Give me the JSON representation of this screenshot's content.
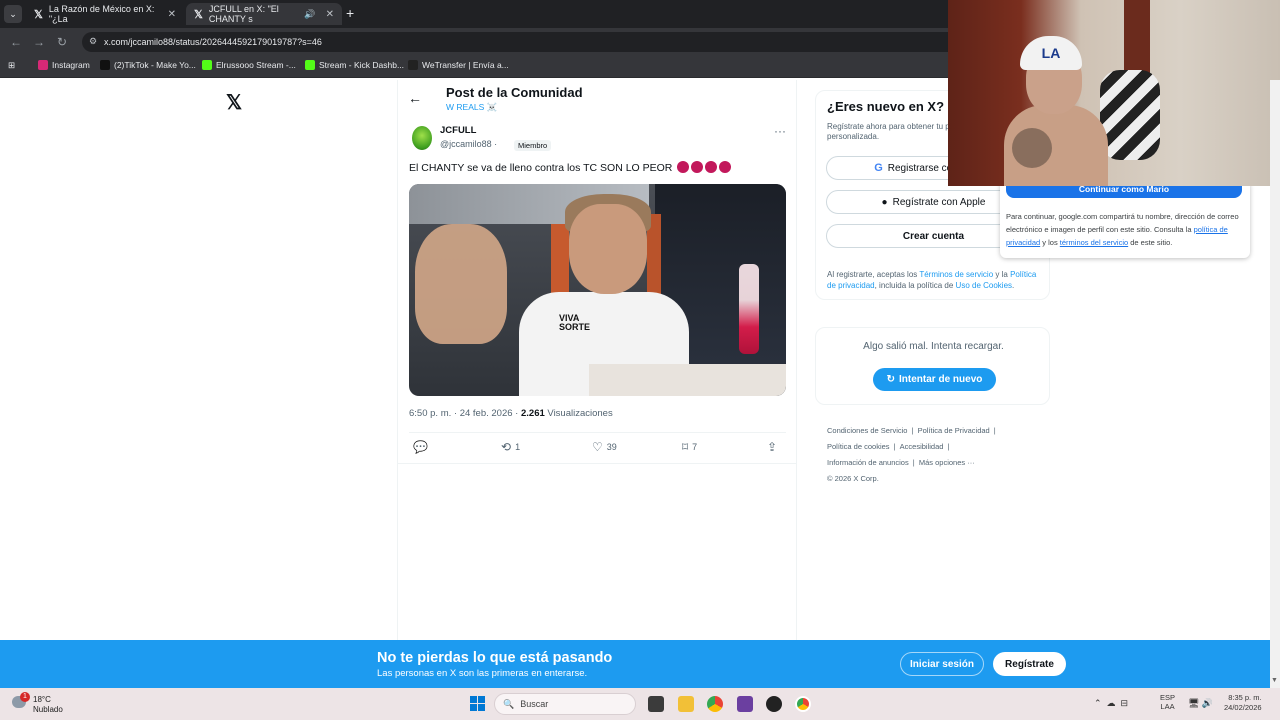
{
  "browser": {
    "tabs": [
      {
        "title": "La Razón de México en X: \"¿La",
        "active": false
      },
      {
        "title": "JCFULL en X: \"El CHANTY s",
        "active": true
      }
    ],
    "url": "x.com/jccamilo88/status/2026444592179019787?s=46",
    "bookmarks": [
      "Instagram",
      "(2)TikTok - Make Yo...",
      "Elrussooo Stream -...",
      "Stream - Kick Dashb...",
      "WeTransfer | Envía a..."
    ]
  },
  "post": {
    "header_title": "Post de la Comunidad",
    "community": "W REALS ☠️",
    "author_name": "JCFULL",
    "author_handle": "@jccamilo88",
    "member_badge": "Miembro",
    "text": "El CHANTY se va de lleno contra los TC SON LO PEOR",
    "time": "6:50 p. m.",
    "date": "24 feb. 2026",
    "views_count": "2.261",
    "views_label": "Visualizaciones",
    "retweets": "1",
    "likes": "39",
    "bookmarks": "7",
    "video_text": [
      "VIVA",
      "SORTE"
    ]
  },
  "sidebar": {
    "new_title": "¿Eres nuevo en X?",
    "new_desc": "Regístrate ahora para obtener tu propia cronología personalizada.",
    "google_label": "Registrarse con Google",
    "apple_label": "Regístrate con Apple",
    "create_label": "Crear cuenta",
    "legal_prefix": "Al registrarte, aceptas los",
    "legal_terms": "Términos de servicio",
    "legal_and": "y la",
    "legal_privacy": "Política de privacidad",
    "legal_mid": ", incluida la política de",
    "legal_cookies": "Uso de Cookies",
    "error_text": "Algo salió mal. Intenta recargar.",
    "retry_label": "Intentar de nuevo",
    "footer_links": [
      "Condiciones de Servicio",
      "Política de Privacidad",
      "Política de cookies",
      "Accesibilidad",
      "Información de anuncios",
      "Más opciones ···"
    ],
    "copyright": "© 2026 X Corp."
  },
  "google_popup": {
    "button": "Continuar como Mario",
    "text_prefix": "Para continuar, google.com compartirá tu nombre, dirección de correo electrónico e imagen de perfil con este sitio. Consulta la",
    "privacy_link": "política de privacidad",
    "text_mid": "y los",
    "terms_link": "términos del servicio",
    "text_suffix": "de este sitio."
  },
  "webcam": {
    "cap_logo": "LA"
  },
  "banner": {
    "title": "No te pierdas lo que está pasando",
    "subtitle": "Las personas en X son las primeras en enterarse.",
    "login": "Iniciar sesión",
    "signup": "Regístrate"
  },
  "taskbar": {
    "temp": "18°C",
    "weather": "Nublado",
    "weather_badge": "1",
    "search_placeholder": "Buscar",
    "lang_1": "ESP",
    "lang_2": "LAA",
    "time": "8:35 p. m.",
    "date": "24/02/2026"
  }
}
